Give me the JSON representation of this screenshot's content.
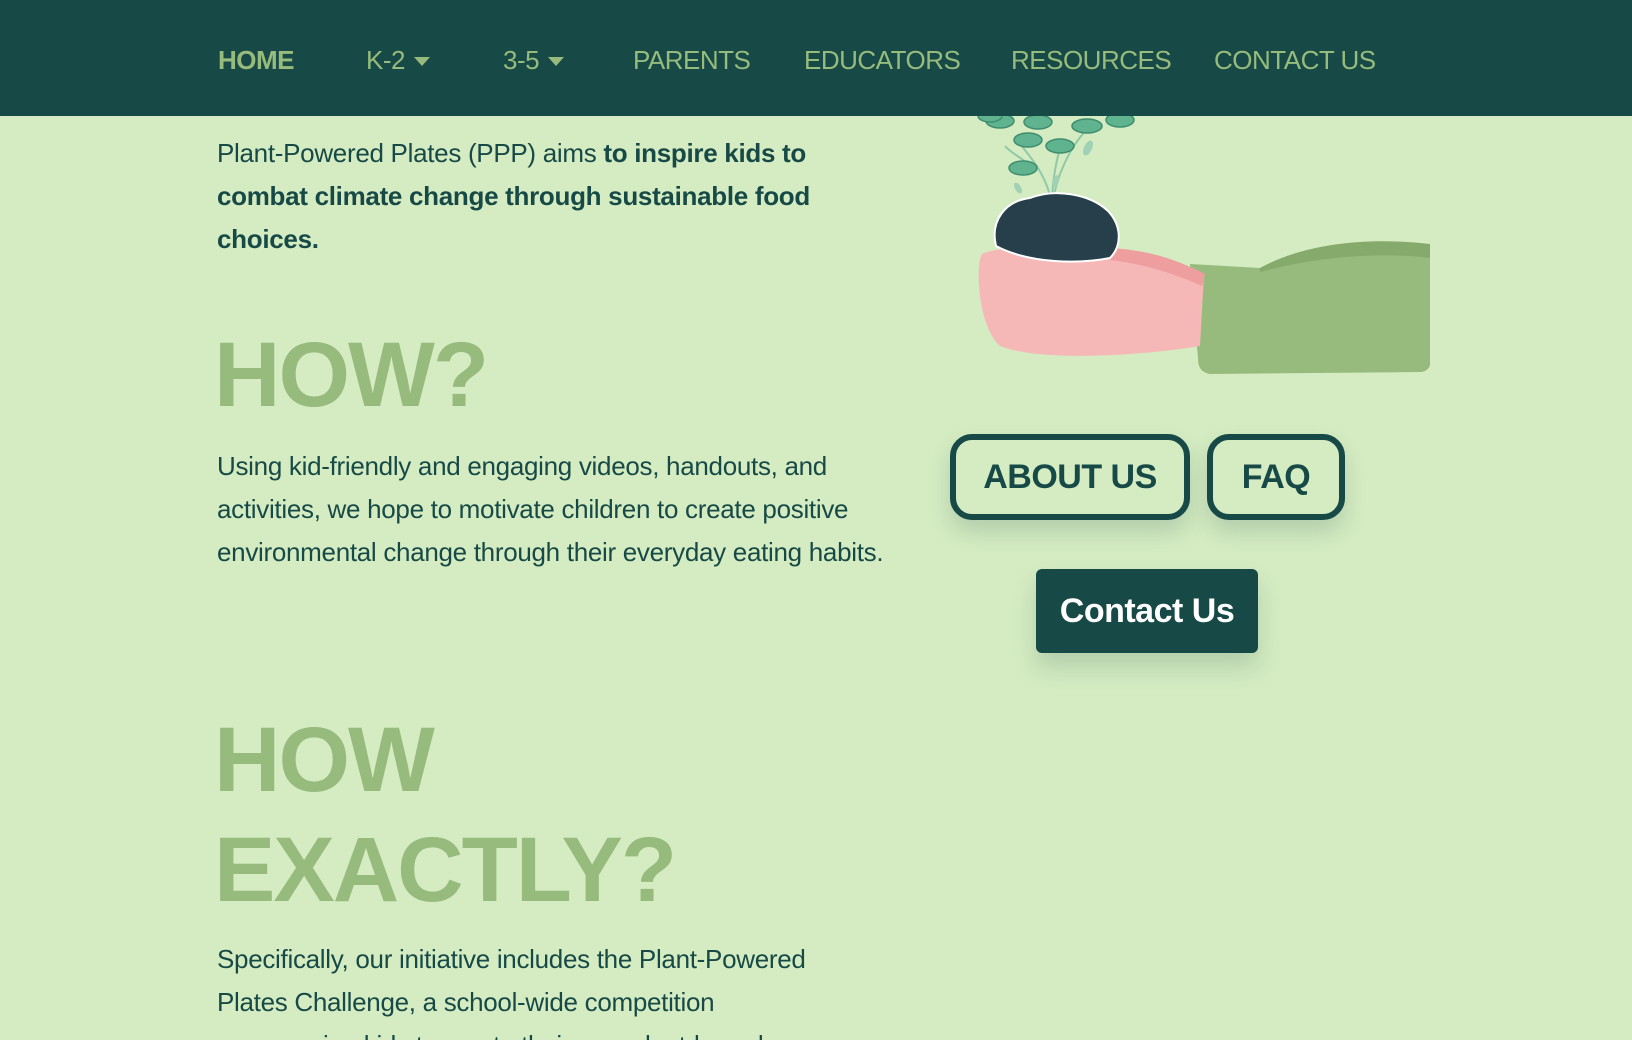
{
  "nav": {
    "home": "HOME",
    "k2": "K-2",
    "g35": "3-5",
    "parents": "PARENTS",
    "educators": "EDUCATORS",
    "resources": "RESOURCES",
    "contact": "CONTACT US"
  },
  "intro": {
    "lead": "Plant-Powered Plates (PPP) aims ",
    "bold": "to inspire kids to combat climate change through sustainable food choices."
  },
  "how": {
    "heading": "HOW?",
    "text": "Using kid-friendly and engaging videos, handouts, and activities, we hope to motivate children to create positive environmental change through their everyday eating habits."
  },
  "how_exactly": {
    "heading_line1": "HOW",
    "heading_line2": "EXACTLY?",
    "text": "Specifically, our initiative includes the Plant-Powered Plates Challenge, a school-wide competition encouraging kids to create their own plant-based"
  },
  "buttons": {
    "about": "ABOUT US",
    "faq": "FAQ",
    "contact": "Contact Us"
  },
  "colors": {
    "background": "#d5ecc2",
    "nav_bg": "#174a46",
    "accent_green": "#96bb7c",
    "text_dark": "#174a46",
    "hand_pink": "#f6b7b7",
    "soil": "#263f4a",
    "leaf": "#5fb38f"
  },
  "icons": {
    "dropdown": "caret-down-icon",
    "illustration": "hand-holding-plant-illustration"
  }
}
